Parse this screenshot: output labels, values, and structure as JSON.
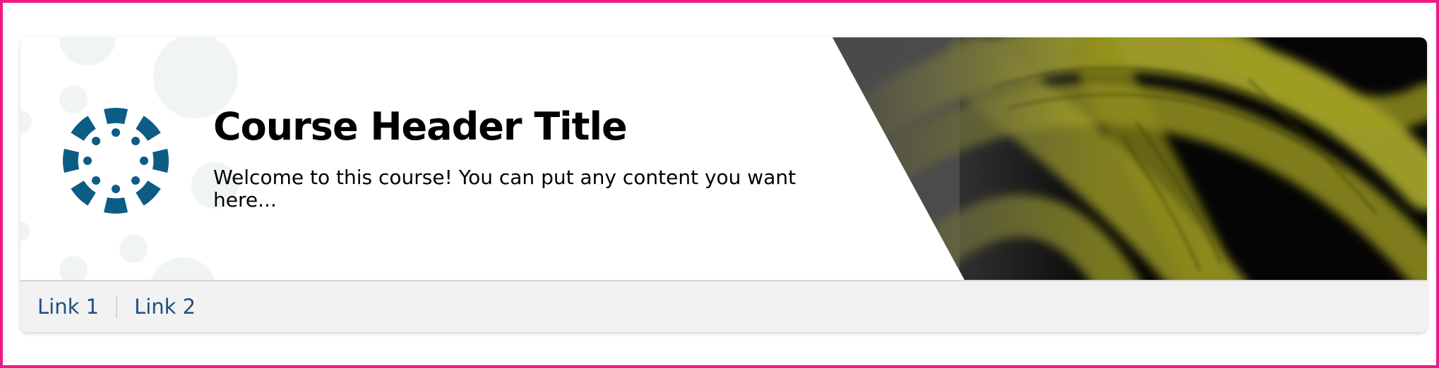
{
  "header": {
    "title": "Course Header Title",
    "subtitle": "Welcome to this course! You can put any content you want here..."
  },
  "nav": {
    "links": [
      {
        "label": "Link 1"
      },
      {
        "label": "Link 2"
      }
    ]
  },
  "logo": {
    "icon": "canvas-logo-icon",
    "color": "#0d5c86"
  },
  "colors": {
    "frame_border": "#ee1a84",
    "link": "#1e4f80",
    "nav_background": "#f2f2f2",
    "banner_accent": "#b5b430",
    "banner_dark": "#050505",
    "banner_gray": "#4a4a4a"
  }
}
